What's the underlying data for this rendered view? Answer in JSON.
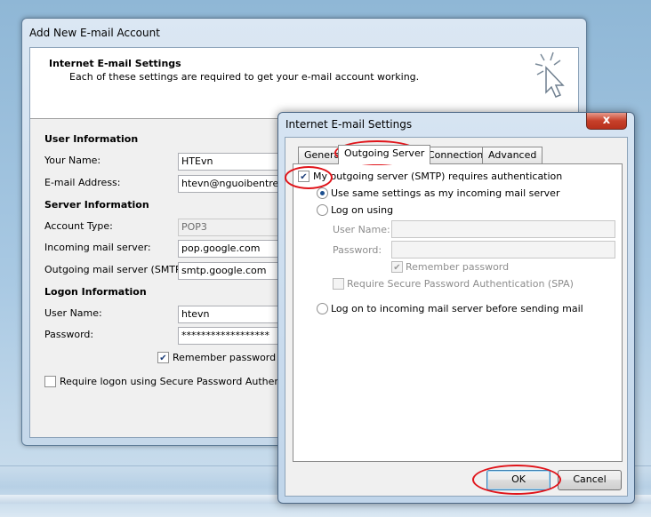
{
  "main_window": {
    "title": "Add New E-mail Account",
    "header_title": "Internet E-mail Settings",
    "header_subtitle": "Each of these settings are required to get your e-mail account working.",
    "user_info": {
      "title": "User Information",
      "your_name_label": "Your Name:",
      "your_name_value": "HTEvn",
      "email_label": "E-mail Address:",
      "email_value": "htevn@nguoibentre.com"
    },
    "server_info": {
      "title": "Server Information",
      "account_type_label": "Account Type:",
      "account_type_value": "POP3",
      "incoming_label": "Incoming mail server:",
      "incoming_value": "pop.google.com",
      "outgoing_label": "Outgoing mail server (SMTP):",
      "outgoing_value": "smtp.google.com"
    },
    "logon_info": {
      "title": "Logon Information",
      "user_name_label": "User Name:",
      "user_name_value": "htevn",
      "password_label": "Password:",
      "password_value": "******************",
      "remember_password_label": "Remember password",
      "remember_password_checked": true,
      "spa_label": "Require logon using Secure Password Authentication (SPA)",
      "spa_checked": false
    }
  },
  "dialog": {
    "title": "Internet E-mail Settings",
    "close_label": "x",
    "tabs": [
      {
        "label": "General"
      },
      {
        "label": "Outgoing Server"
      },
      {
        "label": "Connection"
      },
      {
        "label": "Advanced"
      }
    ],
    "active_tab": "Outgoing Server",
    "smtp_auth_label": "My outgoing server (SMTP) requires authentication",
    "smtp_auth_checked": true,
    "same_settings_label": "Use same settings as my incoming mail server",
    "log_on_using_label": "Log on using",
    "user_name_label": "User Name:",
    "password_label": "Password:",
    "remember_password_label": "Remember password",
    "spa_label": "Require Secure Password Authentication (SPA)",
    "log_on_incoming_label": "Log on to incoming mail server before sending mail",
    "ok_label": "OK",
    "cancel_label": "Cancel"
  },
  "colors": {
    "annotation": "#e0141a",
    "radio_dot": "#1c4f8f"
  }
}
